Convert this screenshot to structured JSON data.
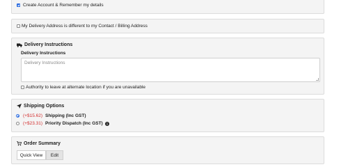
{
  "account": {
    "label": "Create Account & Remember my details",
    "checked": true
  },
  "address": {
    "label": "My Delivery Address is different to my Contact / Billing Address",
    "checked": false
  },
  "delivery": {
    "title": "Delivery Instructions",
    "icon": "truck-icon",
    "field_label": "Delivery Instructions",
    "field_placeholder": "Delivery Instructions",
    "authority_label": "Authority to leave at alternate location if you are unavailable",
    "authority_checked": false
  },
  "shipping": {
    "title": "Shipping Options",
    "icon": "paper-plane-icon",
    "options": [
      {
        "price": "(+$15.62)",
        "name": "Shipping (Inc GST)",
        "selected": true
      },
      {
        "price": "(+$23.31)",
        "name": "Priority Dispatch (Inc GST)",
        "selected": false,
        "info_icon": "info-icon"
      }
    ]
  },
  "summary": {
    "title": "Order Summary",
    "icon": "cart-icon",
    "tabs": [
      {
        "label": "Quick View",
        "active": true
      },
      {
        "label": "Edit",
        "active": false
      }
    ]
  },
  "colors": {
    "accent": "#2a6be0",
    "price": "#d32f2f",
    "panel_bg": "#f4f4f4"
  }
}
